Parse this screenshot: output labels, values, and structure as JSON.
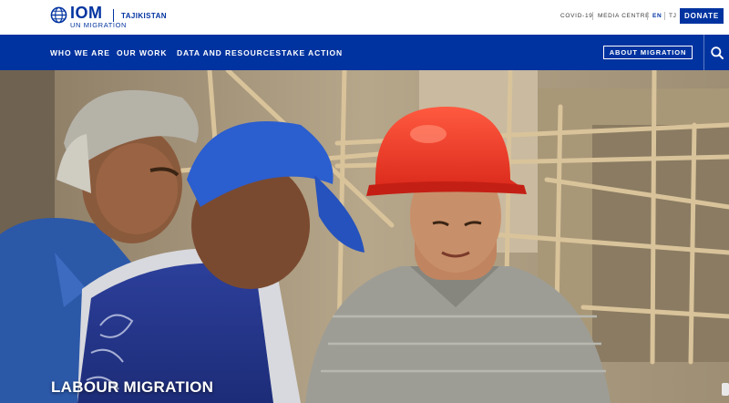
{
  "brand": {
    "logo_text": "IOM",
    "logo_subtext": "UN MIGRATION",
    "country": "TAJIKISTAN",
    "primary_color": "#0033a0"
  },
  "utility": {
    "covid": "COVID-19",
    "media": "MEDIA CENTRE",
    "lang_en": "EN",
    "lang_tj": "TJ",
    "donate": "DONATE"
  },
  "nav": {
    "items": [
      "WHO WE ARE",
      "OUR WORK",
      "DATA AND RESOURCES",
      "TAKE ACTION"
    ],
    "about": "ABOUT MIGRATION",
    "search_icon": "search-icon"
  },
  "hero": {
    "title": "LABOUR MIGRATION"
  }
}
